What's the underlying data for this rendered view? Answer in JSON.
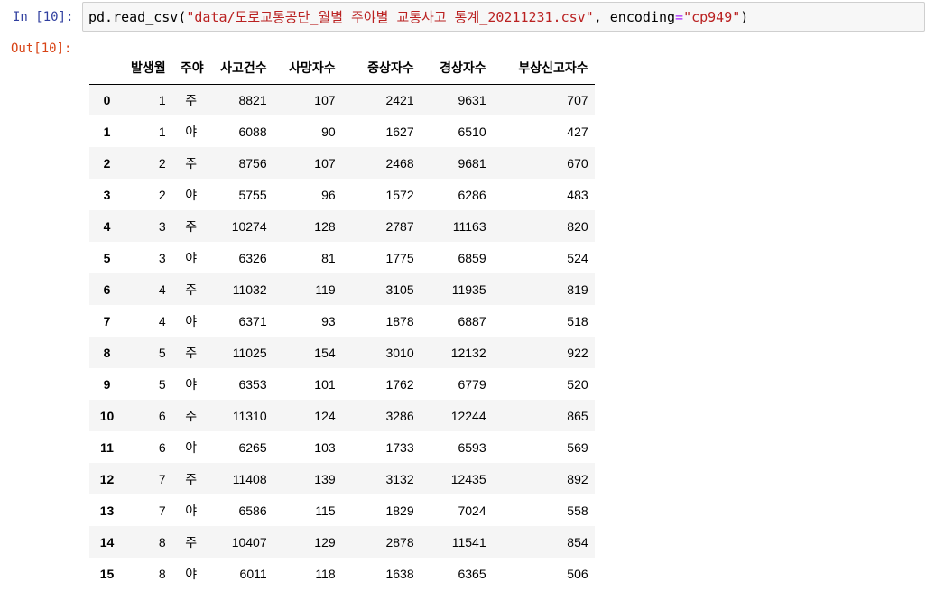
{
  "cell": {
    "in_prompt": "In [10]:",
    "out_prompt": "Out[10]:",
    "code": {
      "prefix": "pd.read_csv(",
      "path_string": "\"data/도로교통공단_월별 주야별 교통사고 통계_20211231.csv\"",
      "middle": ", encoding",
      "equals": "=",
      "encoding_string": "\"cp949\"",
      "suffix": ")"
    }
  },
  "table": {
    "index_header": "",
    "columns": [
      "발생월",
      "주야",
      "사고건수",
      "사망자수",
      "중상자수",
      "경상자수",
      "부상신고자수"
    ],
    "rows": [
      {
        "index": "0",
        "values": [
          "1",
          "주",
          "8821",
          "107",
          "2421",
          "9631",
          "707"
        ]
      },
      {
        "index": "1",
        "values": [
          "1",
          "야",
          "6088",
          "90",
          "1627",
          "6510",
          "427"
        ]
      },
      {
        "index": "2",
        "values": [
          "2",
          "주",
          "8756",
          "107",
          "2468",
          "9681",
          "670"
        ]
      },
      {
        "index": "3",
        "values": [
          "2",
          "야",
          "5755",
          "96",
          "1572",
          "6286",
          "483"
        ]
      },
      {
        "index": "4",
        "values": [
          "3",
          "주",
          "10274",
          "128",
          "2787",
          "11163",
          "820"
        ]
      },
      {
        "index": "5",
        "values": [
          "3",
          "야",
          "6326",
          "81",
          "1775",
          "6859",
          "524"
        ]
      },
      {
        "index": "6",
        "values": [
          "4",
          "주",
          "11032",
          "119",
          "3105",
          "11935",
          "819"
        ]
      },
      {
        "index": "7",
        "values": [
          "4",
          "야",
          "6371",
          "93",
          "1878",
          "6887",
          "518"
        ]
      },
      {
        "index": "8",
        "values": [
          "5",
          "주",
          "11025",
          "154",
          "3010",
          "12132",
          "922"
        ]
      },
      {
        "index": "9",
        "values": [
          "5",
          "야",
          "6353",
          "101",
          "1762",
          "6779",
          "520"
        ]
      },
      {
        "index": "10",
        "values": [
          "6",
          "주",
          "11310",
          "124",
          "3286",
          "12244",
          "865"
        ]
      },
      {
        "index": "11",
        "values": [
          "6",
          "야",
          "6265",
          "103",
          "1733",
          "6593",
          "569"
        ]
      },
      {
        "index": "12",
        "values": [
          "7",
          "주",
          "11408",
          "139",
          "3132",
          "12435",
          "892"
        ]
      },
      {
        "index": "13",
        "values": [
          "7",
          "야",
          "6586",
          "115",
          "1829",
          "7024",
          "558"
        ]
      },
      {
        "index": "14",
        "values": [
          "8",
          "주",
          "10407",
          "129",
          "2878",
          "11541",
          "854"
        ]
      },
      {
        "index": "15",
        "values": [
          "8",
          "야",
          "6011",
          "118",
          "1638",
          "6365",
          "506"
        ]
      }
    ]
  },
  "colors": {
    "in_prompt": "#303f9f",
    "out_prompt": "#d84315",
    "string": "#ba2121",
    "operator": "#aa22ff",
    "row_stripe": "#f5f5f5",
    "input_bg": "#f7f7f7",
    "input_border": "#cfcfcf"
  }
}
